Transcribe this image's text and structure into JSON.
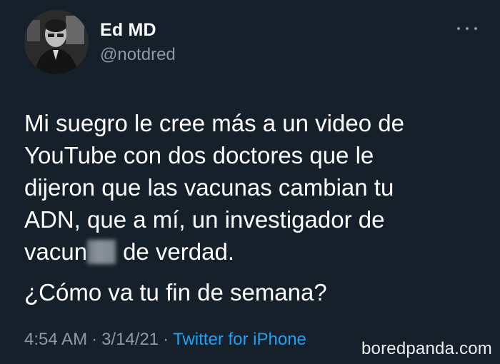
{
  "user": {
    "display_name": "Ed MD",
    "handle": "@notdred"
  },
  "tweet": {
    "lines": [
      "Mi suegro le cree más a un video de",
      "YouTube con dos doctores que le",
      "dijeron que las vacunas cambian tu",
      "ADN, que a mí, un investigador de"
    ],
    "line5_start": "vacun",
    "line5_end": "de verdad.",
    "paragraph2": "¿Cómo va tu fin de semana?"
  },
  "meta": {
    "time": "4:54 AM",
    "separator": "·",
    "date": "3/14/21",
    "source": "Twitter for iPhone"
  },
  "watermark": "boredpanda.com",
  "icons": {
    "more": "more-horizontal-icon",
    "avatar": "profile-photo"
  },
  "colors": {
    "background": "#15202b",
    "text": "#ffffff",
    "secondary_text": "#8b98a5",
    "link": "#1da1f2"
  }
}
